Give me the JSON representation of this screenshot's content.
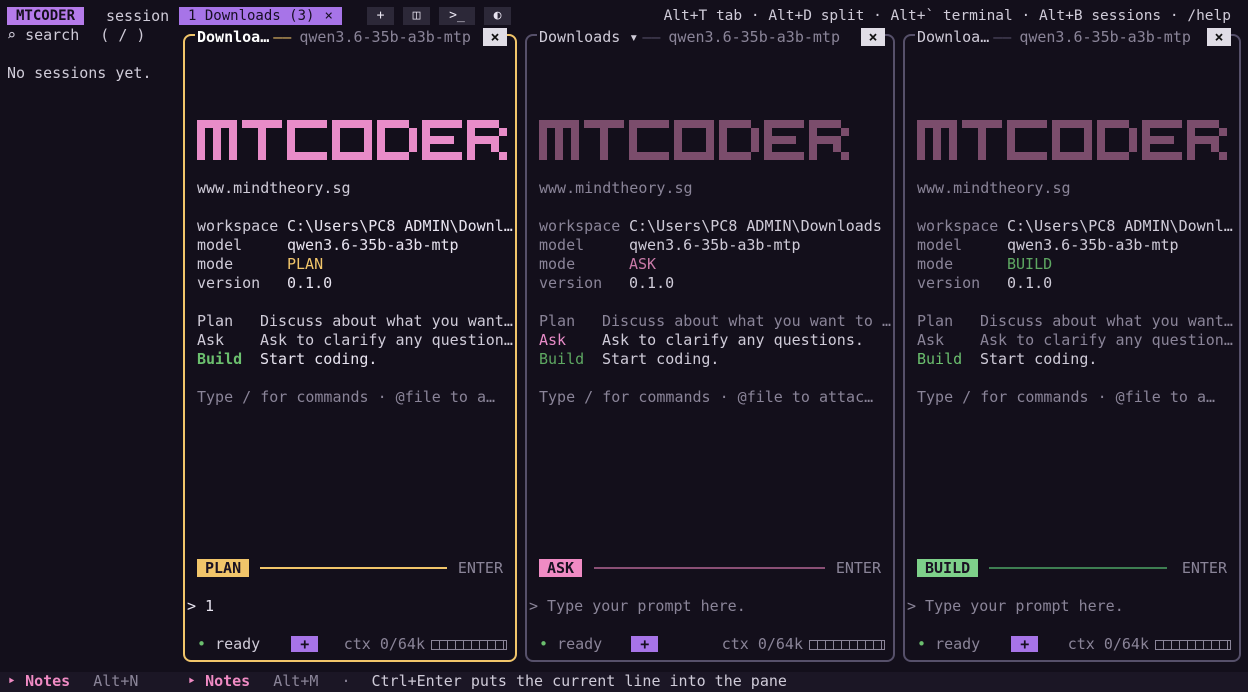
{
  "app": {
    "brand": "MTCODER"
  },
  "topbar": {
    "session_label": "session",
    "active_tab": "1 Downloads (3)",
    "active_tab_close": "×",
    "buttons": [
      "+",
      "◫",
      ">_",
      "◐"
    ],
    "shortcuts": "Alt+T tab · Alt+D split · Alt+` terminal · Alt+B sessions · /help"
  },
  "sidebar": {
    "search_icon": "⌕",
    "search_label": "search",
    "search_hint": "( / )",
    "empty": "No sessions yet."
  },
  "logo_text": "MTCODER",
  "panes": [
    {
      "title": "Downloa…",
      "model_tab": "qwen3.6-35b-a3b-mtp",
      "close": "×",
      "site": "www.mindtheory.sg",
      "workspace_label": "workspace",
      "workspace": "C:\\Users\\PC8 ADMIN\\Downl…",
      "model_label": "model",
      "model": "qwen3.6-35b-a3b-mtp",
      "mode_label": "mode",
      "mode": "PLAN",
      "version_label": "version",
      "version": "0.1.0",
      "plan_k": "Plan",
      "plan_v": "Discuss about what you want…",
      "ask_k": "Ask",
      "ask_v": "Ask to clarify any question…",
      "build_k": "Build",
      "build_v": "Start coding.",
      "help": "Type / for commands  ·  @file to a…",
      "badge": "PLAN",
      "enter": "ENTER",
      "prompt": "> 1",
      "status": "ready",
      "plus": "+",
      "ctx": "ctx 0/64k"
    },
    {
      "title": "Downloads ▾",
      "model_tab": "qwen3.6-35b-a3b-mtp",
      "close": "×",
      "site": "www.mindtheory.sg",
      "workspace_label": "workspace",
      "workspace": "C:\\Users\\PC8 ADMIN\\Downloads",
      "model_label": "model",
      "model": "qwen3.6-35b-a3b-mtp",
      "mode_label": "mode",
      "mode": "ASK",
      "version_label": "version",
      "version": "0.1.0",
      "plan_k": "Plan",
      "plan_v": "Discuss about what you want to …",
      "ask_k": "Ask",
      "ask_v": "Ask to clarify any questions.",
      "build_k": "Build",
      "build_v": "Start coding.",
      "help": "Type / for commands  ·  @file to attac…",
      "badge": "ASK",
      "enter": "ENTER",
      "prompt": "> Type your prompt here.",
      "status": "ready",
      "plus": "+",
      "ctx": "ctx 0/64k"
    },
    {
      "title": "Downloa…",
      "model_tab": "qwen3.6-35b-a3b-mtp",
      "close": "×",
      "site": "www.mindtheory.sg",
      "workspace_label": "workspace",
      "workspace": "C:\\Users\\PC8 ADMIN\\Downl…",
      "model_label": "model",
      "model": "qwen3.6-35b-a3b-mtp",
      "mode_label": "mode",
      "mode": "BUILD",
      "version_label": "version",
      "version": "0.1.0",
      "plan_k": "Plan",
      "plan_v": "Discuss about what you want…",
      "ask_k": "Ask",
      "ask_v": "Ask to clarify any question…",
      "build_k": "Build",
      "build_v": "Start coding.",
      "help": "Type / for commands  ·  @file to a…",
      "badge": "BUILD",
      "enter": "ENTER",
      "prompt": "> Type your prompt here.",
      "status": "ready",
      "plus": "+",
      "ctx": "ctx 0/64k"
    }
  ],
  "bottombar": {
    "left_arrow": "‣",
    "left_label": "Notes",
    "left_key": "Alt+N",
    "right_arrow": "‣",
    "right_label": "Notes",
    "right_key": "Alt+M",
    "right_sep": "·",
    "right_hint": "Ctrl+Enter puts the current line into the pane"
  },
  "colors": {
    "bg": "#130f1b",
    "brand": "#b57bea",
    "active_border": "#f1c56a",
    "plan": "#f1c56a",
    "ask_active": "#f08bc4",
    "ask_dim": "#c87aa8",
    "build": "#6bbf6e",
    "logo_active": "#e88cc8",
    "logo_dim": "#7b4d6c"
  }
}
